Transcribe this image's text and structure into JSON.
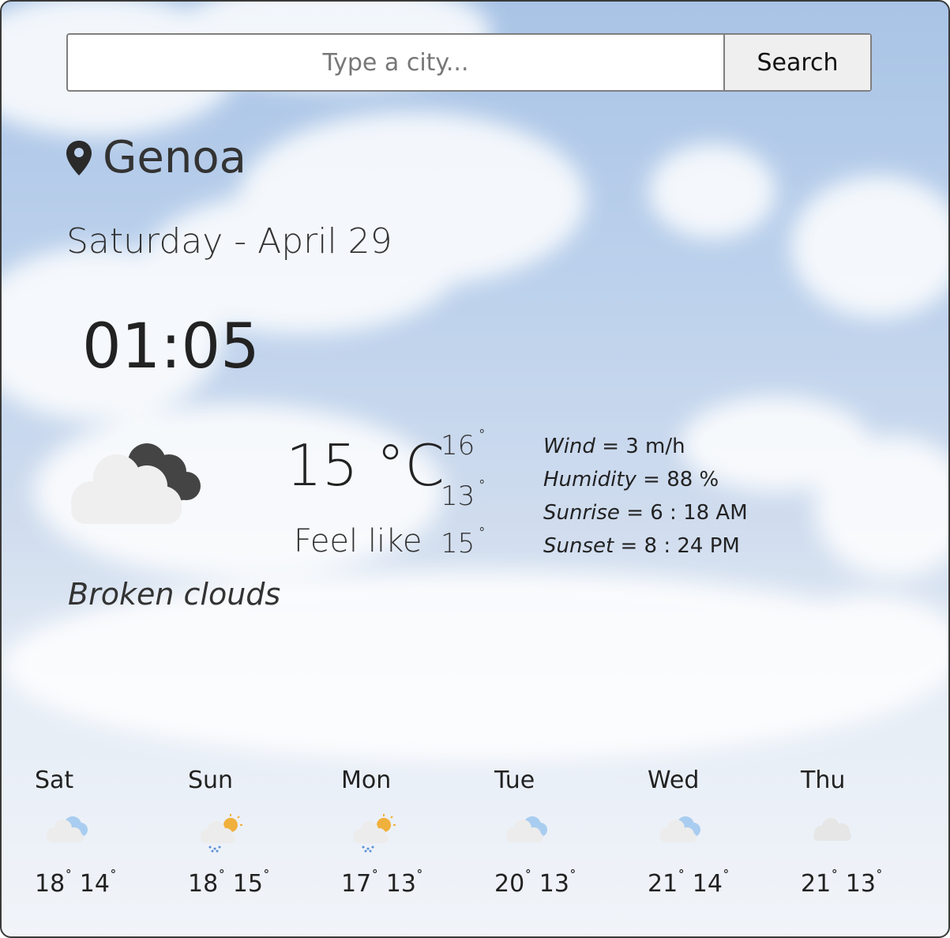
{
  "search": {
    "placeholder": "Type a city...",
    "button_label": "Search"
  },
  "location": {
    "icon": "map-pin-icon",
    "city": "Genoa"
  },
  "date": "Saturday - April 29",
  "time": "01:05",
  "current": {
    "icon": "broken-clouds-icon",
    "temperature": "15 °C",
    "temp_max": "16",
    "temp_min": "13",
    "feels_like_label": "Feel like",
    "feels_like": "15",
    "description": "Broken clouds",
    "details": {
      "wind_label": "Wind",
      "wind_value": "= 3 m/h",
      "humidity_label": "Humidity",
      "humidity_value": "= 88 %",
      "sunrise_label": "Sunrise",
      "sunrise_value": "= 6 : 18 AM",
      "sunset_label": "Sunset",
      "sunset_value": "= 8 : 24 PM"
    }
  },
  "forecast": [
    {
      "day": "Sat",
      "icon": "few-clouds-icon",
      "high": "18",
      "low": "14"
    },
    {
      "day": "Sun",
      "icon": "rain-sun-icon",
      "high": "18",
      "low": "15"
    },
    {
      "day": "Mon",
      "icon": "rain-sun-icon",
      "high": "17",
      "low": "13"
    },
    {
      "day": "Tue",
      "icon": "few-clouds-icon",
      "high": "20",
      "low": "13"
    },
    {
      "day": "Wed",
      "icon": "few-clouds-icon",
      "high": "21",
      "low": "14"
    },
    {
      "day": "Thu",
      "icon": "cloud-icon",
      "high": "21",
      "low": "13"
    }
  ],
  "colors": {
    "sky_top": "#a9c4e6",
    "sky_bottom": "#f1f4f9",
    "text": "#222222"
  }
}
